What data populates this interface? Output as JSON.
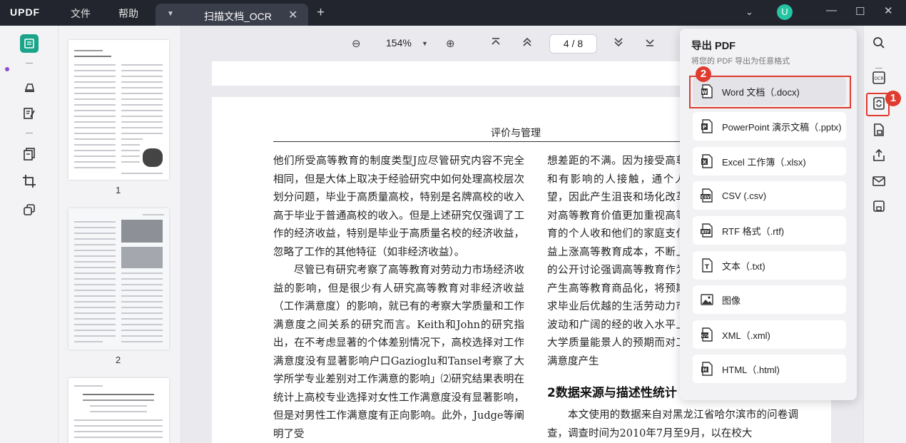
{
  "app": {
    "logo": "UPDF",
    "menu": [
      "文件",
      "帮助"
    ],
    "tab_title": "扫描文档_OCR",
    "avatar_letter": "U"
  },
  "toolbar": {
    "zoom": "154%",
    "page_indicator": "4 / 8"
  },
  "thumbnails": {
    "pages": [
      "1",
      "2"
    ]
  },
  "document": {
    "header": "评价与管理",
    "left_column": "他们所受高等教育的制度类型J应尽管研究内容不完全相同，但是大体上取决于经验研究中如何处理高校层次划分问题，毕业于高质量高校，特别是名牌高校的收入高于毕业于普通高校的收入。但是上述研究仅强调了工作的经济收益，特别是毕业于高质量名校的经济收益，忽略了工作的其他特征（如非经济收益）。",
    "left_column_p2": "尽管已有研究考察了高等教育对劳动力市场经济收益的影响，但是很少有人研究高等教育对非经济收益（工作满意度）的影响，就已有的考察大学质量和工作满意度之间关系的研究而言。Keith和John的研究指出，在不考虑显著的个体差别情况下，高校选择对工作满意度没有显著影响户口Gazioglu和Tansel考察了大学所学专业差别对工作满意的影响」⑵研究结果表明在统计上高校专业选择对女性工作满意度没有显著影响，但是对男性工作满意度有正向影响。此外，Judge等阐明了受",
    "right_column": "想差距的不满。因为接受高尊敬和有影响的人接触，通个人期望，因此产生沮丧和场化改革和对高等教育价值更加重视高等教育的个人收和他们的家庭支付日益上涨高等教育成本，不断上涨的公开讨论强调高等教育作为上产生高等教育商品化，将预期追求毕业后优越的生活劳动力市场波动和广阔的经的收入水平上，大学质量能景人的预期而对工作满意度产生",
    "section_title": "2数据来源与描述性统计",
    "right_column_p2": "本文使用的数据来自对黑龙江省哈尔滨市的问卷调查，调查时间为2010年7月至9月，以在校大"
  },
  "export_popup": {
    "title": "导出 PDF",
    "subtitle": "将您的 PDF 导出为任意格式",
    "options": [
      {
        "label": "Word 文档（.docx)",
        "icon": "word-icon"
      },
      {
        "label": "PowerPoint 演示文稿（.pptx)",
        "icon": "powerpoint-icon"
      },
      {
        "label": "Excel 工作簿（.xlsx)",
        "icon": "excel-icon"
      },
      {
        "label": "CSV (.csv)",
        "icon": "csv-icon"
      },
      {
        "label": "RTF 格式（.rtf)",
        "icon": "rtf-icon"
      },
      {
        "label": "文本（.txt)",
        "icon": "text-icon"
      },
      {
        "label": "图像",
        "icon": "image-icon"
      },
      {
        "label": "XML（.xml)",
        "icon": "xml-icon"
      },
      {
        "label": "HTML（.html)",
        "icon": "html-icon"
      }
    ]
  },
  "annotations": {
    "badge_1": "1",
    "badge_2": "2",
    "accent": "#e03b2f"
  }
}
